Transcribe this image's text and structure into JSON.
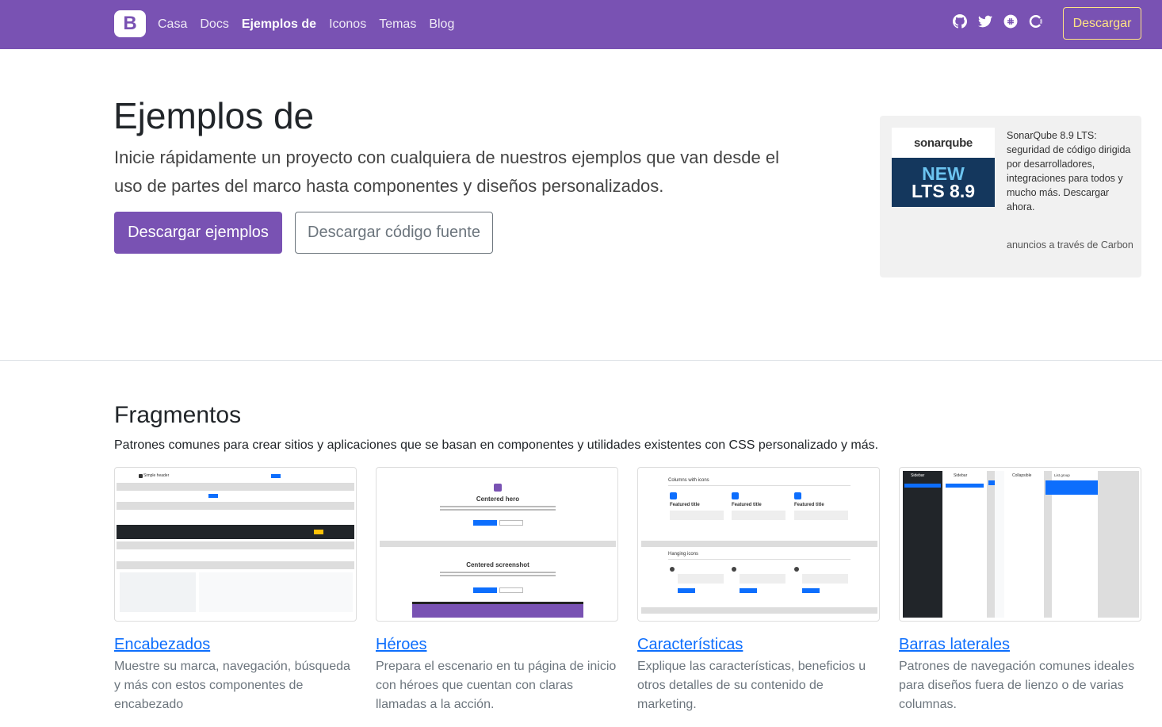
{
  "navbar": {
    "brand": "B",
    "links": [
      "Casa",
      "Docs",
      "Ejemplos de",
      "Iconos",
      "Temas",
      "Blog"
    ],
    "active_index": 2,
    "icons": [
      "github-icon",
      "twitter-icon",
      "slack-icon",
      "opencollective-icon"
    ],
    "download_label": "Descargar",
    "color": "#7952b3"
  },
  "hero": {
    "title": "Ejemplos de",
    "lead": "Inicie rápidamente un proyecto con cualquiera de nuestros ejemplos que van desde el uso de partes del marco hasta componentes y diseños personalizados.",
    "primary_button": "Descargar ejemplos",
    "secondary_button": "Descargar código fuente"
  },
  "ad": {
    "logo_text": "sonarqube",
    "badge_new": "NEW",
    "badge_version": "LTS 8.9",
    "text": "SonarQube 8.9 LTS: seguridad de código dirigida por desarrolladores, integraciones para todos y mucho más. Descargar ahora.",
    "powered_by": "anuncios a través de Carbon"
  },
  "snippets": {
    "title": "Fragmentos",
    "lead": "Patrones comunes para crear sitios y aplicaciones que se basan en componentes y utilidades existentes con CSS personalizado y más.",
    "cards": [
      {
        "title": "Encabezados",
        "text": "Muestre su marca, navegación, búsqueda y más con estos componentes de encabezado"
      },
      {
        "title": "Héroes",
        "text": "Prepara el escenario en tu página de inicio con héroes que cuentan con claras llamadas a la acción."
      },
      {
        "title": "Características",
        "text": "Explique las características, beneficios u otros detalles de su contenido de marketing."
      },
      {
        "title": "Barras laterales",
        "text": "Patrones de navegación comunes ideales para diseños fuera de lienzo o de varias columnas."
      }
    ],
    "thumb_texts": {
      "headers": "Simple header",
      "hero_1": "Centered hero",
      "hero_2": "Centered screenshot",
      "features_1": "Columns with icons",
      "features_2": "Hanging icons",
      "feature_item": "Featured title",
      "sidebar_1": "Sidebar",
      "sidebar_2": "Collapsible",
      "sidebar_3": "List group"
    }
  }
}
